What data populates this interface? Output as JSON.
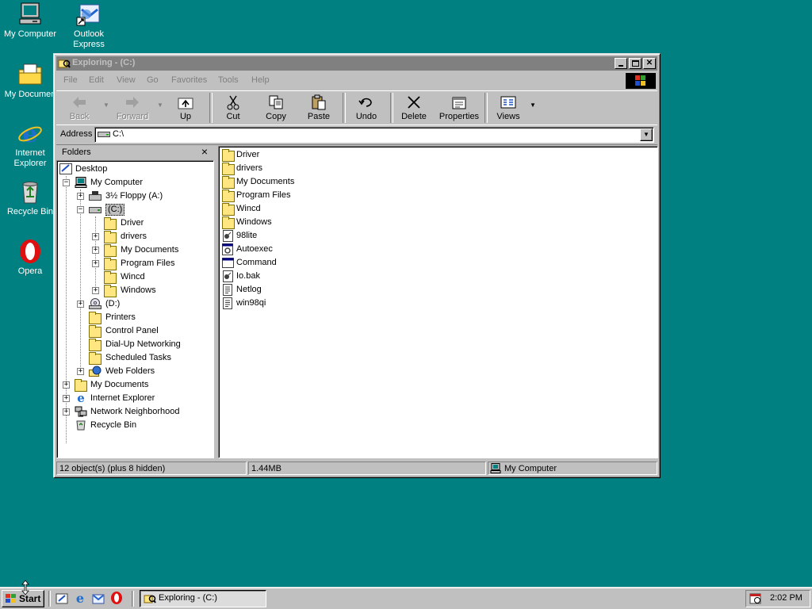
{
  "desktop": {
    "icons": [
      {
        "label_line1": "My Computer",
        "label_line2": "",
        "icon": "my-computer-icon"
      },
      {
        "label_line1": "Outlook",
        "label_line2": "Express",
        "icon": "outlook-express-icon"
      },
      {
        "label_line1": "My Documen",
        "label_line2": "",
        "icon": "my-documents-icon"
      },
      {
        "label_line1": "Internet",
        "label_line2": "Explorer",
        "icon": "internet-explorer-icon"
      },
      {
        "label_line1": "Recycle Bin",
        "label_line2": "",
        "icon": "recycle-bin-icon"
      },
      {
        "label_line1": "Opera",
        "label_line2": "",
        "icon": "opera-icon"
      }
    ]
  },
  "window": {
    "title": "Exploring - (C:)",
    "menu": [
      "File",
      "Edit",
      "View",
      "Go",
      "Favorites",
      "Tools",
      "Help"
    ],
    "toolbar": {
      "back": "Back",
      "forward": "Forward",
      "up": "Up",
      "cut": "Cut",
      "copy": "Copy",
      "paste": "Paste",
      "undo": "Undo",
      "delete": "Delete",
      "properties": "Properties",
      "views": "Views"
    },
    "address": {
      "label": "Address",
      "value": "C:\\"
    },
    "folders_pane": {
      "title": "Folders",
      "close": "×",
      "tree": [
        {
          "label": "Desktop",
          "icon": "desktop-icon"
        },
        {
          "label": "My Computer",
          "icon": "my-computer-icon"
        },
        {
          "label": "3½ Floppy (A:)",
          "icon": "floppy-drive-icon"
        },
        {
          "label": "(C:)",
          "icon": "hard-drive-icon"
        },
        {
          "label": "Driver",
          "icon": "folder-icon"
        },
        {
          "label": "drivers",
          "icon": "folder-icon"
        },
        {
          "label": "My Documents",
          "icon": "my-documents-folder-icon"
        },
        {
          "label": "Program Files",
          "icon": "folder-icon"
        },
        {
          "label": "Wincd",
          "icon": "folder-icon"
        },
        {
          "label": "Windows",
          "icon": "folder-icon"
        },
        {
          "label": "(D:)",
          "icon": "cd-drive-icon"
        },
        {
          "label": "Printers",
          "icon": "printers-folder-icon"
        },
        {
          "label": "Control Panel",
          "icon": "control-panel-icon"
        },
        {
          "label": "Dial-Up Networking",
          "icon": "dial-up-networking-icon"
        },
        {
          "label": "Scheduled Tasks",
          "icon": "scheduled-tasks-icon"
        },
        {
          "label": "Web Folders",
          "icon": "web-folders-icon"
        },
        {
          "label": "My Documents",
          "icon": "my-documents-folder-icon"
        },
        {
          "label": "Internet Explorer",
          "icon": "internet-explorer-icon"
        },
        {
          "label": "Network Neighborhood",
          "icon": "network-neighborhood-icon"
        },
        {
          "label": "Recycle Bin",
          "icon": "recycle-bin-icon"
        }
      ]
    },
    "files": [
      {
        "name": "Driver",
        "icon": "folder-icon"
      },
      {
        "name": "drivers",
        "icon": "folder-icon"
      },
      {
        "name": "My Documents",
        "icon": "my-documents-folder-icon"
      },
      {
        "name": "Program Files",
        "icon": "folder-icon"
      },
      {
        "name": "Wincd",
        "icon": "folder-icon"
      },
      {
        "name": "Windows",
        "icon": "folder-icon"
      },
      {
        "name": "98lite",
        "icon": "batch-file-icon"
      },
      {
        "name": "Autoexec",
        "icon": "system-file-icon"
      },
      {
        "name": "Command",
        "icon": "ms-dos-program-icon"
      },
      {
        "name": "Io.bak",
        "icon": "batch-file-icon"
      },
      {
        "name": "Netlog",
        "icon": "text-document-icon"
      },
      {
        "name": "win98qi",
        "icon": "text-document-icon"
      }
    ],
    "status": {
      "objects": "12 object(s) (plus 8 hidden)",
      "size": "1.44MB",
      "location": "My Computer"
    }
  },
  "taskbar": {
    "start": "Start",
    "task_button": "Exploring - (C:)",
    "clock": "2:02 PM",
    "quick_launch": [
      "show-desktop-icon",
      "internet-explorer-icon",
      "outlook-express-icon",
      "opera-icon"
    ]
  },
  "colors": {
    "desktop": "#008080",
    "inactive_title": "#808080",
    "face": "#c0c0c0"
  }
}
